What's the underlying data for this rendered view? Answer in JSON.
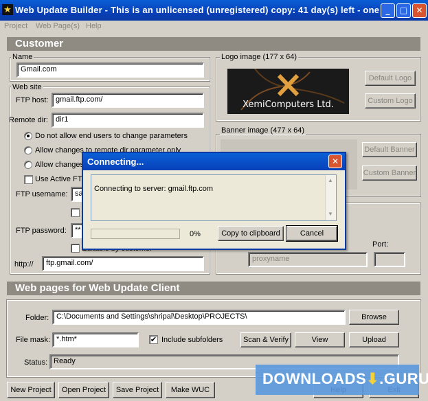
{
  "window": {
    "title": "Web Update Builder - This is an unlicensed (unregistered) copy: 41 day(s) left - one",
    "minimize": "_",
    "maximize": "□",
    "close": "✕"
  },
  "menu": [
    "Project",
    "Web Page(s)",
    "Help"
  ],
  "customer": {
    "header": "Customer",
    "name_label": "Name",
    "name_value": "Gmail.com",
    "website_label": "Web site",
    "ftp_host_label": "FTP host:",
    "ftp_host_value": "gmail.ftp.com/",
    "remote_dir_label": "Remote dir:",
    "remote_dir_value": "dir1",
    "radio_options": [
      "Do not allow end users to change parameters",
      "Allow changes to remote dir parameter only",
      "Allow changes"
    ],
    "use_active_ftp_label": "Use Active FTP",
    "ftp_username_label": "FTP username:",
    "ftp_username_value": "sa",
    "ftp_password_label": "FTP password:",
    "ftp_password_value": "**",
    "editable_by_customer_label": "Editable by customer",
    "http_label": "http://",
    "http_value": "ftp.gmail.com/",
    "logo_label": "Logo image (177 x 64)",
    "logo_text": "XemiComputers Ltd.",
    "default_logo": "Default Logo",
    "custom_logo": "Custom Logo",
    "banner_label": "Banner image (477 x 64)",
    "default_banner": "Default Banner",
    "custom_banner": "Custom Banner",
    "port_label": "Port:",
    "proxy_placeholder": "proxyname"
  },
  "webpages": {
    "header": "Web pages for Web Update Client",
    "folder_label": "Folder:",
    "folder_value": "C:\\Documents and Settings\\shripal\\Desktop\\PROJECTS\\",
    "browse": "Browse",
    "file_mask_label": "File mask:",
    "file_mask_value": "*.htm*",
    "include_subfolders_label": "Include subfolders",
    "include_subfolders_check": "✔",
    "scan_verify": "Scan & Verify",
    "view": "View",
    "upload": "Upload",
    "status_label": "Status:",
    "status_value": "Ready"
  },
  "bottom_buttons": [
    "New Project",
    "Open Project",
    "Save Project",
    "Make WUC",
    "Help",
    "Exit"
  ],
  "dialog": {
    "title": "Connecting...",
    "close": "✕",
    "message": "Connecting to server: gmail.ftp.com",
    "progress_percent": "0%",
    "progress_fraction": 0,
    "copy_button": "Copy to clipboard",
    "cancel_button": "Cancel"
  },
  "watermark": {
    "text": "DOWNLOADS",
    "suffix": ".GURU"
  },
  "colors": {
    "titlebar": "#0a5fd6",
    "section_header": "#8f8b83",
    "dialog_title": "#0a5fd6",
    "close_button": "#d9552f",
    "watermark": "#5a98de"
  }
}
